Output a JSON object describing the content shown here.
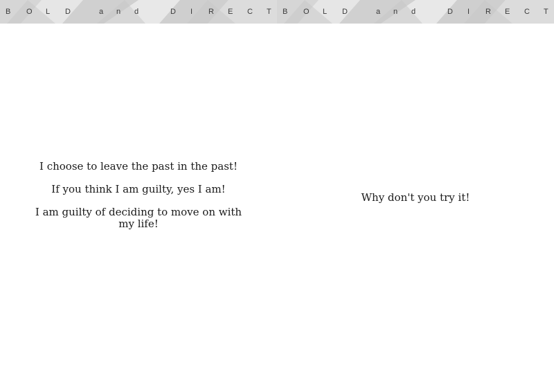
{
  "header": {
    "title_letters": [
      "B",
      "O",
      "L",
      "D",
      "a",
      "n",
      "d",
      "D",
      "I",
      "R",
      "E",
      "C",
      "T"
    ]
  },
  "left_page": {
    "lines": [
      "I choose to leave the past in the past!",
      "If you think I am guilty, yes I am!",
      "I am guilty of deciding to move on with my life!"
    ]
  },
  "right_page": {
    "lines": [
      "Why don't you try it!"
    ]
  },
  "colors": {
    "header_light": "#e3e3e3",
    "header_mid": "#d2d2d2",
    "header_dark": "#c4c4c4",
    "text": "#1a1a1a"
  }
}
